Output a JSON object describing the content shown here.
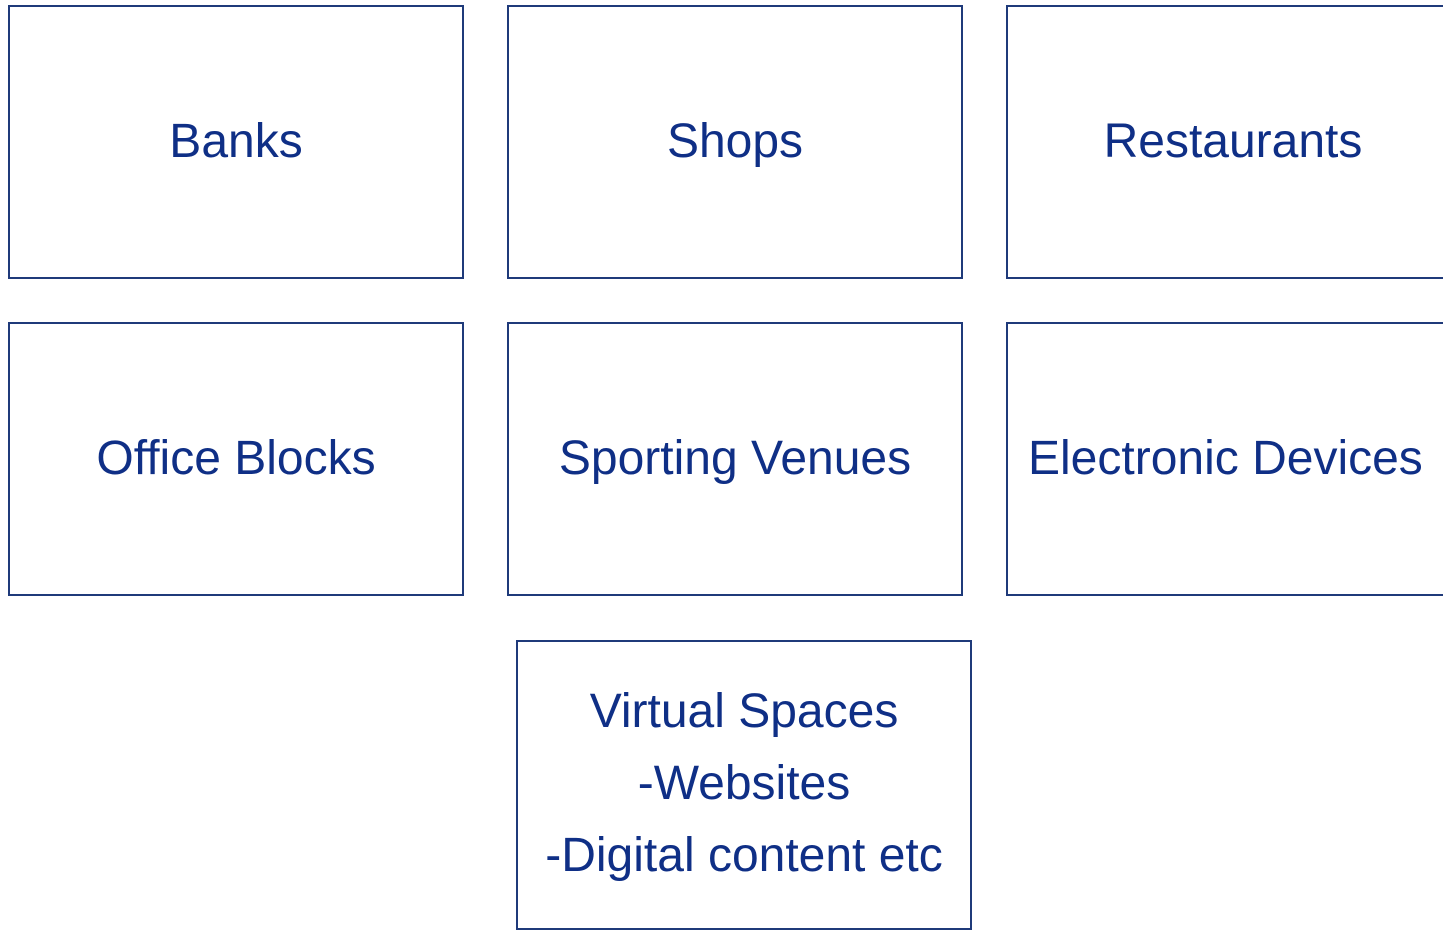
{
  "diagram": {
    "boxes": [
      {
        "id": "banks",
        "label": "Banks"
      },
      {
        "id": "shops",
        "label": "Shops"
      },
      {
        "id": "restaurants",
        "label": "Restaurants"
      },
      {
        "id": "office_blocks",
        "label": "Office Blocks"
      },
      {
        "id": "sporting_venues",
        "label": "Sporting Venues"
      },
      {
        "id": "electronic_devices",
        "label": "Electronic Devices"
      }
    ],
    "virtual_spaces": {
      "lines": [
        "Virtual Spaces",
        "-Websites",
        "-Digital content etc"
      ]
    }
  },
  "colors": {
    "border": "#1f3a7a",
    "text": "#0f2f86",
    "background": "#ffffff"
  }
}
